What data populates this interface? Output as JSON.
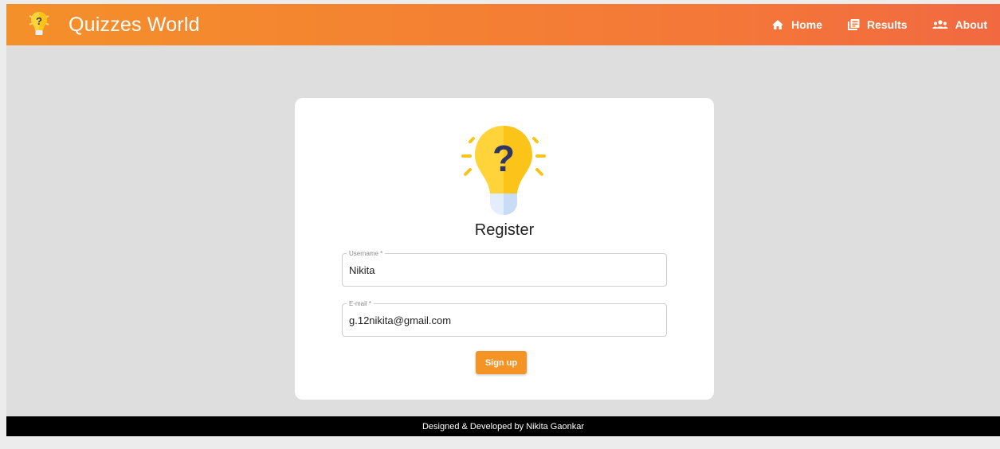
{
  "header": {
    "brand_title": "Quizzes World",
    "nav": [
      {
        "label": "Home",
        "icon": "home-icon"
      },
      {
        "label": "Results",
        "icon": "results-icon"
      },
      {
        "label": "About",
        "icon": "people-icon"
      }
    ]
  },
  "form": {
    "title": "Register",
    "username": {
      "label": "Username *",
      "value": "Nikita"
    },
    "email": {
      "label": "E-mail *",
      "value": "g.12nikita@gmail.com"
    },
    "submit_label": "Sign up"
  },
  "footer": {
    "text": "Designed & Developed by Nikita Gaonkar"
  },
  "colors": {
    "header_start": "#f4902a",
    "header_end": "#f26941",
    "button": "#f59324",
    "bulb": "#ffd43b",
    "question_mark": "#2f3566"
  }
}
